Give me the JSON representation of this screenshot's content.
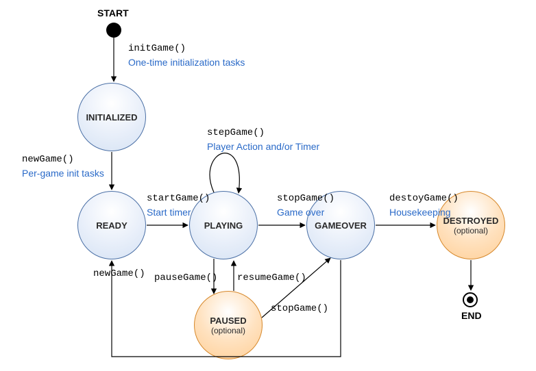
{
  "title_start": "START",
  "title_end": "END",
  "states": {
    "initialized": "INITIALIZED",
    "ready": "READY",
    "playing": "PLAYING",
    "gameover": "GAMEOVER",
    "destroyed": "DESTROYED",
    "destroyed_opt": "(optional)",
    "paused": "PAUSED",
    "paused_opt": "(optional)"
  },
  "trans": {
    "initGame": "initGame()",
    "initGame_desc": "One-time initialization tasks",
    "newGame": "newGame()",
    "newGame_desc": "Per-game init tasks",
    "startGame": "startGame()",
    "startGame_desc": "Start timer",
    "stepGame": "stepGame()",
    "stepGame_desc": "Player Action and/or Timer",
    "stopGame": "stopGame()",
    "stopGame_desc": "Game over",
    "destroyGame": "destoyGame()",
    "destroyGame_desc": "Housekeeping",
    "pauseGame": "pauseGame()",
    "resumeGame": "resumeGame()",
    "stopGame2": "stopGame()",
    "newGame2": "newGame()"
  },
  "diagram": {
    "type": "state-machine",
    "start": "START",
    "end": "END",
    "nodes": [
      {
        "id": "INITIALIZED",
        "optional": false
      },
      {
        "id": "READY",
        "optional": false
      },
      {
        "id": "PLAYING",
        "optional": false
      },
      {
        "id": "GAMEOVER",
        "optional": false
      },
      {
        "id": "DESTROYED",
        "optional": true
      },
      {
        "id": "PAUSED",
        "optional": true
      }
    ],
    "edges": [
      {
        "from": "START",
        "to": "INITIALIZED",
        "label": "initGame()",
        "desc": "One-time initialization tasks"
      },
      {
        "from": "INITIALIZED",
        "to": "READY",
        "label": "newGame()",
        "desc": "Per-game init tasks"
      },
      {
        "from": "READY",
        "to": "PLAYING",
        "label": "startGame()",
        "desc": "Start timer"
      },
      {
        "from": "PLAYING",
        "to": "PLAYING",
        "label": "stepGame()",
        "desc": "Player Action and/or Timer"
      },
      {
        "from": "PLAYING",
        "to": "GAMEOVER",
        "label": "stopGame()",
        "desc": "Game over"
      },
      {
        "from": "GAMEOVER",
        "to": "DESTROYED",
        "label": "destoyGame()",
        "desc": "Housekeeping"
      },
      {
        "from": "DESTROYED",
        "to": "END"
      },
      {
        "from": "PLAYING",
        "to": "PAUSED",
        "label": "pauseGame()"
      },
      {
        "from": "PAUSED",
        "to": "PLAYING",
        "label": "resumeGame()"
      },
      {
        "from": "PAUSED",
        "to": "GAMEOVER",
        "label": "stopGame()"
      },
      {
        "from": "GAMEOVER",
        "to": "READY",
        "label": "newGame()"
      }
    ]
  }
}
